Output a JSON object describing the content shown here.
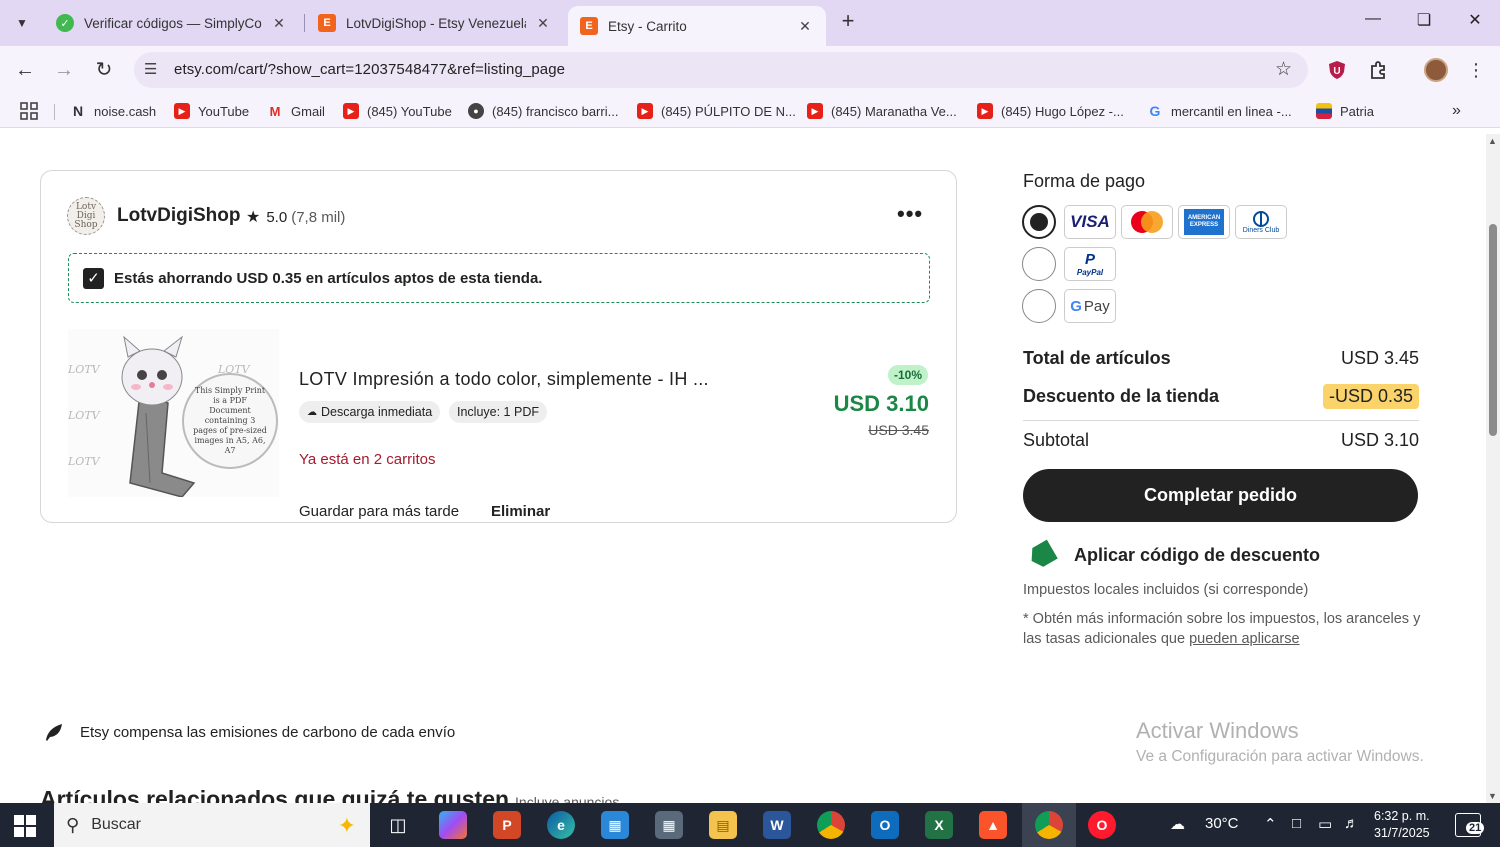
{
  "browser": {
    "tabs": [
      {
        "title": "Verificar códigos — SimplyCod",
        "active": false
      },
      {
        "title": "LotvDigiShop - Etsy Venezuela",
        "active": false
      },
      {
        "title": "Etsy - Carrito",
        "active": true
      }
    ],
    "url": "etsy.com/cart/?show_cart=12037548477&ref=listing_page",
    "bookmarks": [
      {
        "label": "noise.cash",
        "icon": "noise-cash-icon"
      },
      {
        "label": "YouTube",
        "icon": "youtube-icon"
      },
      {
        "label": "Gmail",
        "icon": "gmail-icon"
      },
      {
        "label": "(845) YouTube",
        "icon": "youtube-icon"
      },
      {
        "label": "(845) francisco barri...",
        "icon": "globe-icon"
      },
      {
        "label": "(845) PÚLPITO DE N...",
        "icon": "youtube-icon"
      },
      {
        "label": "(845) Maranatha Ve...",
        "icon": "youtube-icon"
      },
      {
        "label": "(845) Hugo López -...",
        "icon": "youtube-icon"
      },
      {
        "label": "mercantil en linea -...",
        "icon": "google-icon"
      },
      {
        "label": "Patria",
        "icon": "patria-icon"
      }
    ]
  },
  "cart": {
    "shop": {
      "name": "LotvDigiShop",
      "logo_text": "Lotv Digi Shop",
      "rating": "5.0",
      "reviews": "(7,8 mil)"
    },
    "savings_text": "Estás ahorrando USD 0.35 en artículos aptos de esta tienda.",
    "item": {
      "title": "LOTV Impresión a todo color, simplemente - IH ...",
      "chip_download": "Descarga inmediata",
      "chip_includes": "Incluye: 1 PDF",
      "in_carts": "Ya está en 2 carritos",
      "save_later": "Guardar para más tarde",
      "remove": "Eliminar",
      "discount_badge": "-10%",
      "price": "USD 3.10",
      "original_price": "USD 3.45",
      "image_watermark": "LOTV",
      "image_circle_text": "This Simply Print is a PDF Document containing 3 pages of pre-sized images in A5, A6, A7"
    }
  },
  "summary": {
    "payment_title": "Forma de pago",
    "payment_methods": [
      "VISA",
      "Mastercard",
      "American Express",
      "Diners Club",
      "PayPal",
      "G Pay"
    ],
    "items_total_label": "Total de artículos",
    "items_total_value": "USD 3.45",
    "shop_discount_label": "Descuento de la tienda",
    "shop_discount_value": "-USD 0.35",
    "subtotal_label": "Subtotal",
    "subtotal_value": "USD 3.10",
    "checkout_label": "Completar pedido",
    "coupon_label": "Aplicar código de descuento",
    "tax_note": "Impuestos locales incluidos (si corresponde)",
    "more_info_prefix": "* Obtén más información sobre los impuestos, los aranceles y las tasas adicionales que ",
    "more_info_link": "pueden aplicarse"
  },
  "carbon_text": "Etsy compensa las emisiones de carbono de cada envío",
  "related_title": "Artículos relacionados que quizá te gusten",
  "related_sub": "Incluye anuncios",
  "watermark": {
    "line1": "Activar Windows",
    "line2": "Ve a Configuración para activar Windows."
  },
  "taskbar": {
    "search_placeholder": "Buscar",
    "temperature": "30°C",
    "time": "6:32 p. m.",
    "date": "31/7/2025",
    "notifications": "21"
  },
  "colors": {
    "tabbar": "#e2d8f4",
    "price_green": "#1b8747",
    "discount_highlight": "#fad36b",
    "checkout_button": "#222222"
  }
}
